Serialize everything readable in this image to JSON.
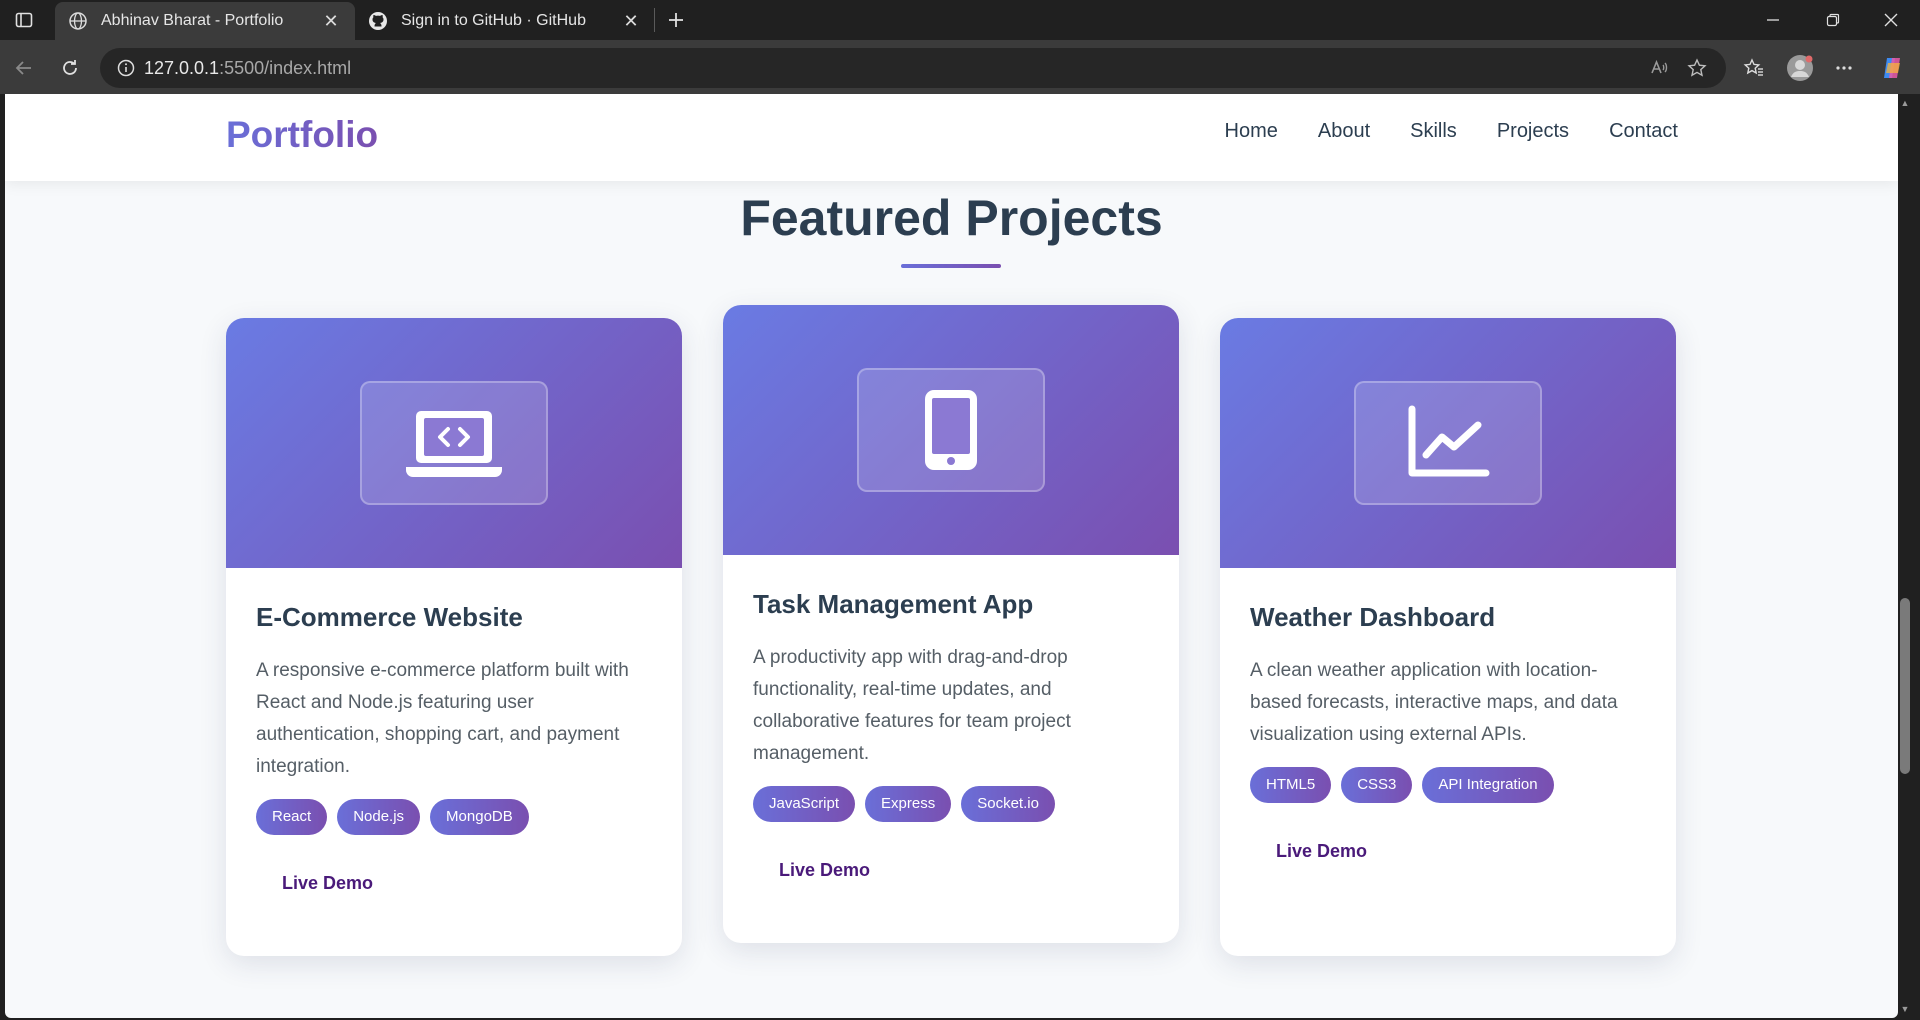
{
  "browser": {
    "tabs": [
      {
        "title": "Abhinav Bharat - Portfolio",
        "active": true
      },
      {
        "title": "Sign in to GitHub · GitHub",
        "active": false
      }
    ],
    "url_host": "127.0.0.1",
    "url_rest": ":5500/index.html"
  },
  "nav": {
    "logo": "Portfolio",
    "links": [
      "Home",
      "About",
      "Skills",
      "Projects",
      "Contact"
    ]
  },
  "section": {
    "title": "Featured Projects"
  },
  "projects": [
    {
      "icon": "laptop-code-icon",
      "title": "E-Commerce Website",
      "description": "A responsive e-commerce platform built with React and Node.js featuring user authentication, shopping cart, and payment integration.",
      "tags": [
        "React",
        "Node.js",
        "MongoDB"
      ],
      "link": "Live Demo"
    },
    {
      "icon": "mobile-icon",
      "title": "Task Management App",
      "description": "A productivity app with drag-and-drop functionality, real-time updates, and collaborative features for team project management.",
      "tags": [
        "JavaScript",
        "Express",
        "Socket.io"
      ],
      "link": "Live Demo"
    },
    {
      "icon": "chart-line-icon",
      "title": "Weather Dashboard",
      "description": "A clean weather application with location-based forecasts, interactive maps, and data visualization using external APIs.",
      "tags": [
        "HTML5",
        "CSS3",
        "API Integration"
      ],
      "link": "Live Demo"
    }
  ],
  "colors": {
    "accent_start": "#6a7be3",
    "accent_end": "#7a4fb0",
    "heading": "#2c3e50",
    "link": "#4a1a7a"
  }
}
